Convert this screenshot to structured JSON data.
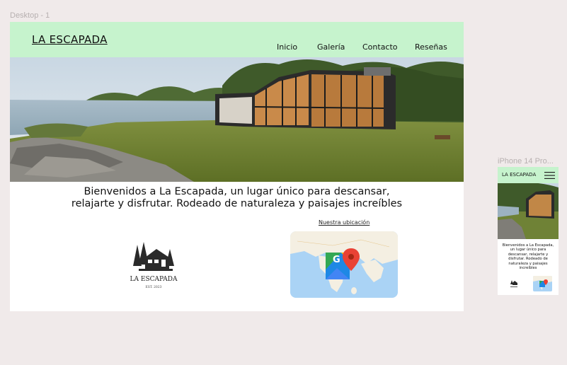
{
  "canvas": {
    "desktop_frame_label": "Desktop - 1",
    "phone_frame_label": "iPhone 14 Pro..."
  },
  "site": {
    "brand": "LA ESCAPADA",
    "nav": [
      "Inicio",
      "Galería",
      "Contacto",
      "Reseñas"
    ],
    "welcome_line1": "Bienvenidos a La Escapada, un lugar único para descansar,",
    "welcome_line2": "relajarte y disfrutar. Rodeado de naturaleza y paisajes increíbles",
    "map_link": "Nuestra ubicación",
    "logo_name": "LA ESCAPADA",
    "logo_est": "EST. 2023"
  },
  "phone": {
    "brand": "LA ESCAPADA",
    "welcome": "Bienvenidos a La Escapada, un lugar único para descansar, relajarte y disfrutar. Rodeado de naturaleza y paisajes increíbles"
  },
  "icons": {
    "menu": "hamburger-icon",
    "map_pin": "map-pin-icon",
    "cabin": "cabin-logo-icon"
  },
  "colors": {
    "canvas_bg": "#f0eaea",
    "header_green": "#c6f3cd",
    "map_water": "#aad3f5",
    "map_land": "#f4efe2",
    "pin_red": "#e94235"
  }
}
